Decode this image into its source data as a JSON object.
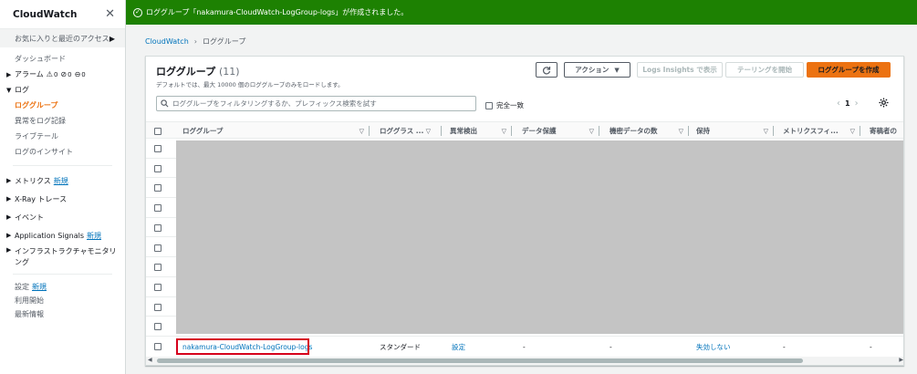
{
  "sidebar": {
    "title": "CloudWatch",
    "favorites": "お気に入りと最近のアクセス",
    "dashboard": "ダッシュボード",
    "alarm": {
      "label": "アラーム",
      "alarm_count": "0",
      "ok_count": "0",
      "insufficient_count": "0"
    },
    "logs": {
      "label": "ログ",
      "items": [
        "ロググループ",
        "異常をログ記録",
        "ライブテール",
        "ログのインサイト"
      ]
    },
    "metrics": "メトリクス",
    "xray": "X-Ray トレース",
    "events": "イベント",
    "app_signals": "Application Signals",
    "infra": "インフラストラクチャモニタリング",
    "new_badge": "新規",
    "settings": "設定",
    "getting_started": "利用開始",
    "whats_new": "最新情報"
  },
  "flash": {
    "message": "ロググループ「nakamura-CloudWatch-LogGroup-logs」が作成されました。"
  },
  "breadcrumb": {
    "root": "CloudWatch",
    "current": "ロググループ"
  },
  "panel": {
    "title": "ロググループ",
    "count": "(11)",
    "description": "デフォルトでは、最大 10000 個のロググループのみをロードします。",
    "buttons": {
      "action": "アクション",
      "insights": "Logs Insights で表示",
      "tailing": "テーリングを開始",
      "create": "ロググループを作成"
    },
    "filter_placeholder": "ロググループをフィルタリングするか、プレフィックス検索を試す",
    "exact_match": "完全一致",
    "page": "1"
  },
  "table": {
    "columns": [
      "ロググループ",
      "ロググラス ...",
      "異常検出",
      "データ保護",
      "機密データの数",
      "保持",
      "メトリクスフィ...",
      "寄稿者の"
    ],
    "last_row": {
      "name": "nakamura-CloudWatch-LogGroup-logs",
      "class": "スタンダード",
      "anomaly": "設定",
      "protection": "-",
      "sensitive": "-",
      "retention": "失効しない",
      "metric_filters": "-",
      "contributors": "-"
    }
  }
}
